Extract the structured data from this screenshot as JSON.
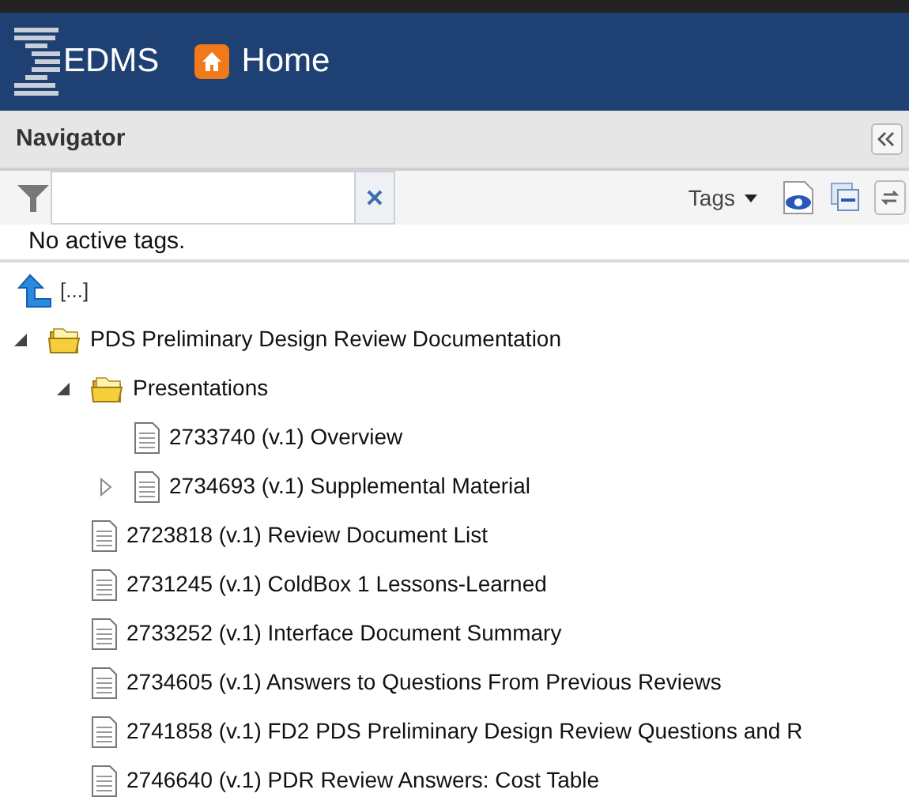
{
  "header": {
    "logo": "EDMS",
    "home_link": "Home"
  },
  "navigator": {
    "title": "Navigator",
    "tags_menu": "Tags",
    "no_tags_message": "No active tags."
  },
  "tree": {
    "parent_link": "[...]",
    "items": [
      {
        "kind": "folder",
        "label": "PDS Preliminary Design Review Documentation",
        "expanded": true,
        "children": [
          {
            "kind": "folder",
            "label": "Presentations",
            "expanded": true,
            "children": [
              {
                "kind": "document",
                "label": "2733740 (v.1) Overview"
              },
              {
                "kind": "document",
                "label": "2734693 (v.1) Supplemental Material",
                "expanded": false
              }
            ]
          },
          {
            "kind": "document",
            "label": "2723818 (v.1) Review Document List"
          },
          {
            "kind": "document",
            "label": "2731245 (v.1) ColdBox 1 Lessons-Learned"
          },
          {
            "kind": "document",
            "label": "2733252 (v.1) Interface Document Summary"
          },
          {
            "kind": "document",
            "label": "2734605 (v.1) Answers to Questions From Previous Reviews"
          },
          {
            "kind": "document",
            "label": "2741858 (v.1) FD2 PDS Preliminary Design Review Questions and R"
          },
          {
            "kind": "document",
            "label": "2746640 (v.1) PDR Review Answers: Cost Table"
          }
        ]
      }
    ]
  }
}
